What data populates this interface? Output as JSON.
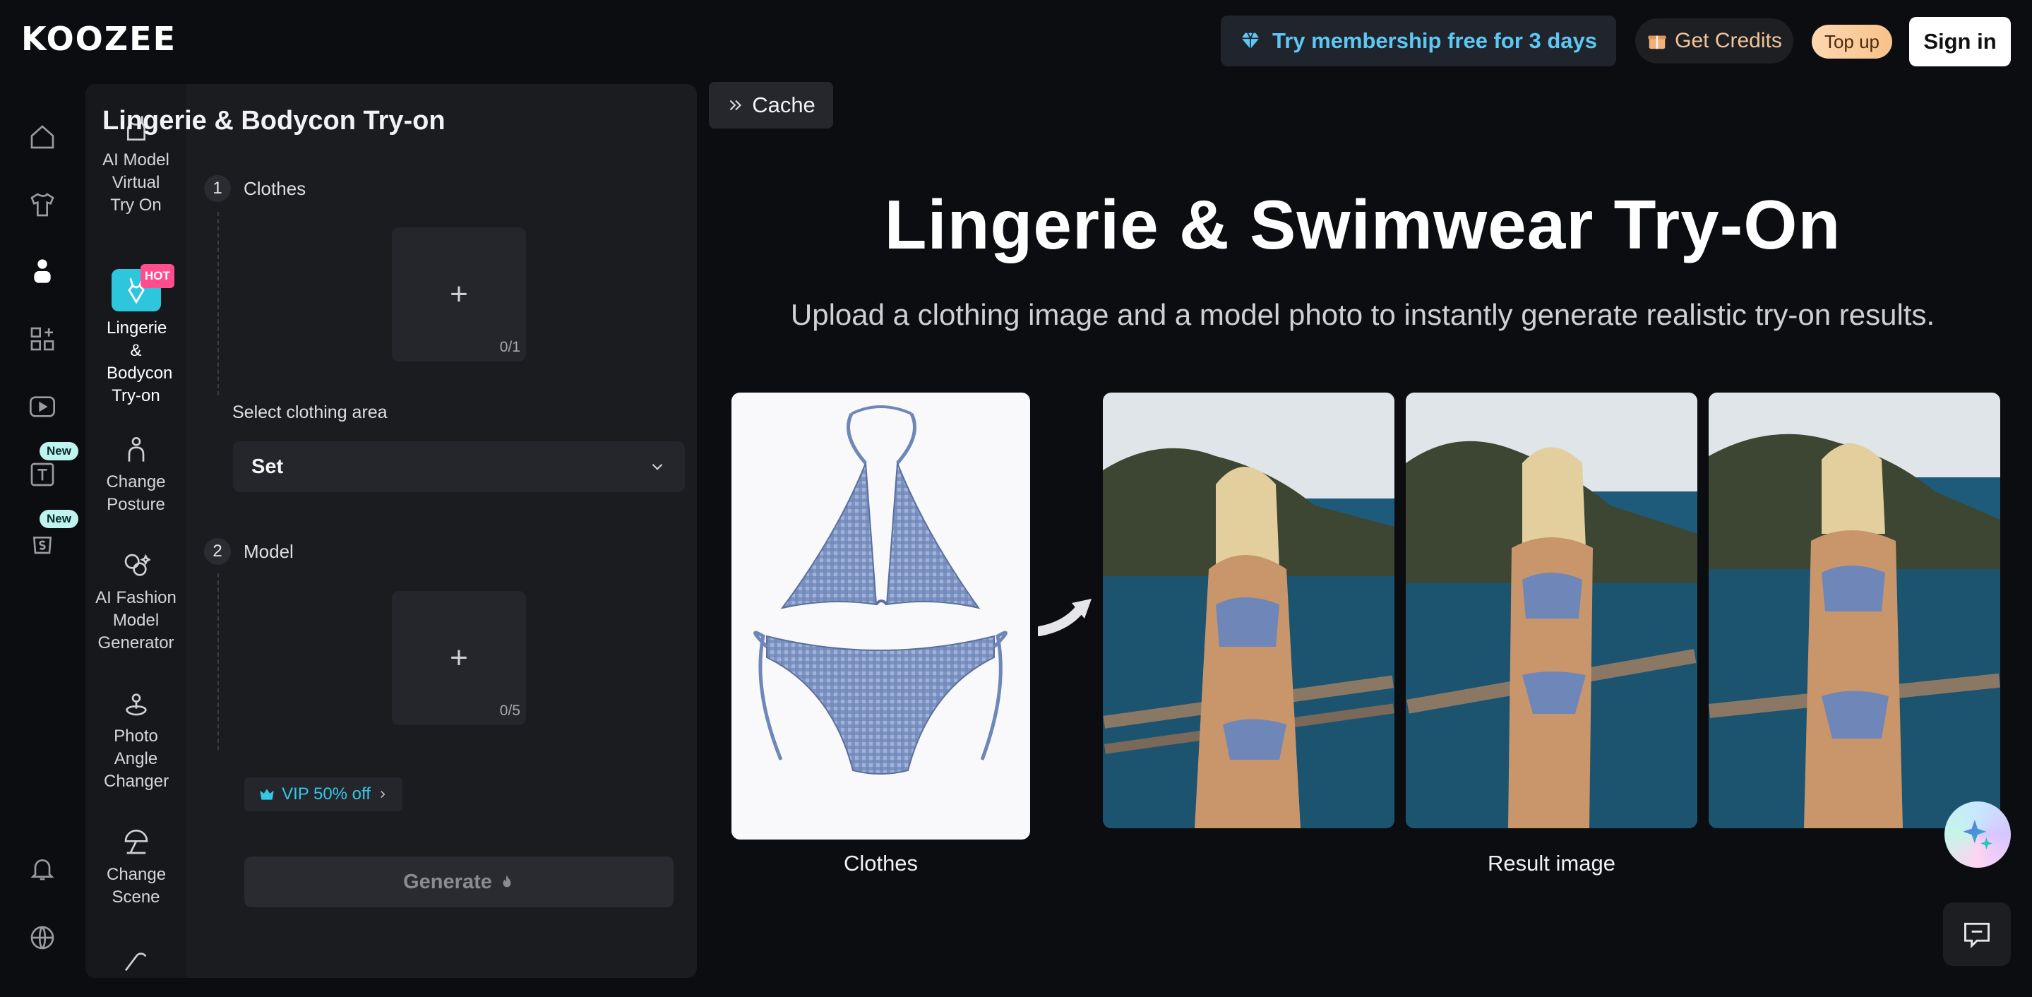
{
  "header": {
    "logo": "KOOZEE",
    "membership_label": "Try membership free for 3 days",
    "credits_label": "Get Credits",
    "topup_label": "Top up",
    "signin_label": "Sign in"
  },
  "rail": {
    "icons": [
      "home-icon",
      "shirt-icon",
      "person-icon",
      "apps-icon",
      "video-icon",
      "text-icon",
      "shop-bag-icon",
      "bell-icon",
      "globe-icon"
    ],
    "badges": [
      "New",
      "New"
    ]
  },
  "tools": [
    {
      "label": "AI Model Virtual Try On",
      "icon": "tank-top-icon"
    },
    {
      "label": "Lingerie & Bodycon Try-on",
      "icon": "bodysuit-icon",
      "badge": "HOT"
    },
    {
      "label": "Change Posture",
      "icon": "posture-icon"
    },
    {
      "label": "AI Fashion Model Generator",
      "icon": "model-generator-icon"
    },
    {
      "label": "Photo Angle Changer",
      "icon": "angle-icon"
    },
    {
      "label": "Change Scene",
      "icon": "umbrella-icon"
    }
  ],
  "form": {
    "title": "Lingerie & Bodycon Try-on",
    "step1_num": "1",
    "step1_label": "Clothes",
    "clothes_count": "0/1",
    "area_label": "Select clothing area",
    "area_value": "Set",
    "step2_num": "2",
    "step2_label": "Model",
    "model_count": "0/5",
    "vip_label": "VIP 50% off",
    "generate_label": "Generate"
  },
  "main": {
    "cache_label": "Cache",
    "title": "Lingerie & Swimwear Try-On",
    "subtitle": "Upload a clothing image and a model photo to instantly generate realistic try-on results.",
    "clothes_caption": "Clothes",
    "result_caption": "Result image"
  },
  "colors": {
    "accent": "#2dc6dd",
    "membership_text": "#5cc8f4",
    "hot_badge": "#ff4d8d",
    "new_badge": "#bff3ee",
    "bikini": "#6f86b8"
  }
}
